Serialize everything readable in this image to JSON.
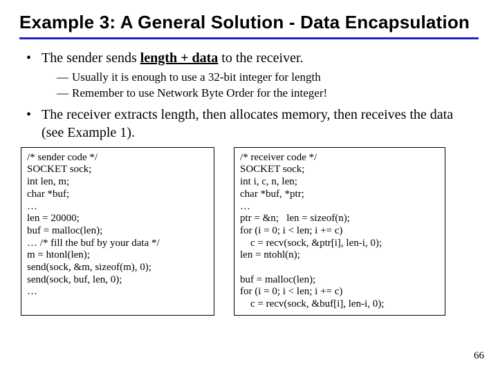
{
  "title": "Example 3: A General Solution - Data Encapsulation",
  "bullet1_pre": "The sender sends ",
  "bullet1_bold": "length + data",
  "bullet1_post": " to the receiver.",
  "sub1": "Usually it is enough to use a 32-bit integer for length",
  "sub2": "Remember to use Network Byte Order for the integer!",
  "bullet2": "The receiver extracts length, then allocates memory, then receives the data (see Example 1).",
  "sender_code": "/* sender code */\nSOCKET sock;\nint len, m;\nchar *buf;\n…\nlen = 20000;\nbuf = malloc(len);\n… /* fill the buf by your data */\nm = htonl(len);\nsend(sock, &m, sizeof(m), 0);\nsend(sock, buf, len, 0);\n…",
  "receiver_code": "/* receiver code */\nSOCKET sock;\nint i, c, n, len;\nchar *buf, *ptr;\n…\nptr = &n;   len = sizeof(n);\nfor (i = 0; i < len; i += c)\n    c = recv(sock, &ptr[i], len-i, 0);\nlen = ntohl(n);\n\nbuf = malloc(len);\nfor (i = 0; i < len; i += c)\n    c = recv(sock, &buf[i], len-i, 0);",
  "page_number": "66"
}
